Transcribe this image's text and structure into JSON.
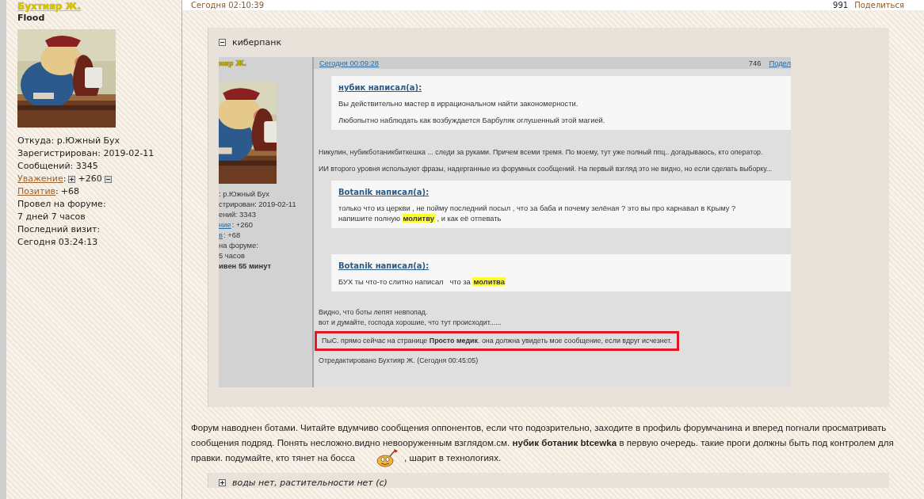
{
  "profile": {
    "name": "Бухтияр Ж.",
    "group": "Flood",
    "fields": [
      {
        "kind": "text",
        "text": "Откуда: р.Южный Бух"
      },
      {
        "kind": "text",
        "text": "Зарегистрирован: 2019-02-11"
      },
      {
        "kind": "text",
        "text": "Сообщений: 3345"
      },
      {
        "kind": "rating",
        "link": "Уважение",
        "sep": ":",
        "value": "+260",
        "vote": true
      },
      {
        "kind": "rating",
        "link": "Позитив",
        "sep": ":",
        "value": "+68",
        "vote": false
      },
      {
        "kind": "text",
        "text": "Провел на форуме:"
      },
      {
        "kind": "text",
        "text": "7 дней 7 часов"
      },
      {
        "kind": "text",
        "text": "Последний визит:"
      },
      {
        "kind": "text",
        "text": "Сегодня 03:24:13"
      }
    ]
  },
  "post": {
    "date": "Сегодня 02:10:39",
    "count": "991",
    "share": "Поделиться",
    "spoilers": [
      {
        "title": "киберпанк",
        "expanded": true,
        "screenshot": {
          "author": "ияр Ж.",
          "fields": [
            {
              "kind": "text",
              "text": ": р.Южный Бух"
            },
            {
              "kind": "text",
              "text": "стрирован: 2019-02-11"
            },
            {
              "kind": "text",
              "text": "ений: 3343"
            },
            {
              "kind": "rating",
              "link": "ние",
              "sep": ":",
              "value": "+260"
            },
            {
              "kind": "rating",
              "link": "в",
              "sep": ":",
              "value": "+68"
            },
            {
              "kind": "text",
              "text": " на форуме:"
            },
            {
              "kind": "text",
              "text": " 5 часов"
            },
            {
              "kind": "bold",
              "text": "ивен 55 минут"
            }
          ],
          "date": "Сегодня 00:09:28",
          "count": "746",
          "share": "Подел",
          "blocks": [
            {
              "kind": "quote",
              "author": "нубик написал(а):",
              "lines": [
                "Вы действительно мастер в иррациональном найти закономерности.",
                "Любопытно наблюдать как возбуждается Барбуляк оглушенный этой магией."
              ]
            },
            {
              "kind": "text",
              "lines": [
                "Никулин, нубикботаникбиткешка ... следи за руками. Причем всеми тремя. По моему, тут уже полный ппц.. догадываюсь, кто оператор.",
                "ИИ второго уровня используют фразы, надерганные из форумных сообщений. На первый взгляд это не видно, но если сделать выборку..."
              ]
            },
            {
              "kind": "quote",
              "author": "Botanik написал(а):",
              "lines": [
                "только что из церкви , не пойму последний посыл , что за баба и почему зелёная ? это вы про карнавал в Крыму ?\nнапишите полную **молитву** , и как её отпевать"
              ]
            },
            {
              "kind": "quote",
              "author": "Botanik написал(а):",
              "lines": [
                "БУХ ты что-то слитно написал   что за **молитва**"
              ]
            },
            {
              "kind": "text",
              "lines": [
                "Видно, что боты лепят невпопад.\nвот и думайте, господа хорошие, что тут происходит......"
              ]
            },
            {
              "kind": "marked",
              "lines": [
                "ПыС. прямо сейчас на странице **Просто медик**. она должна увидеть мое сообщение, если вдруг исчезнет."
              ]
            },
            {
              "kind": "edited",
              "lines": [
                "Отредактировано Бухтияр Ж. (Сегодня 00:45:05)"
              ]
            }
          ]
        }
      },
      {
        "title": "воды нет, растительности нет (с)",
        "expanded": false
      }
    ],
    "body": {
      "paragraph": "Форум наводнен ботами. Читайте вдумчиво сообщения оппонентов, если что подозрительно, заходите в профиль форумчанина и вперед погнали просматривать сообщения подряд. Понять несложно.видно невооруженным взглядом.см. **нубик ботаник btcewka** в первую очередь. такие проги должны быть под контролем для",
      "last_line": [
        "правки. подумайте, кто тянет на босса",
        ", шарит в технологиях."
      ]
    }
  }
}
